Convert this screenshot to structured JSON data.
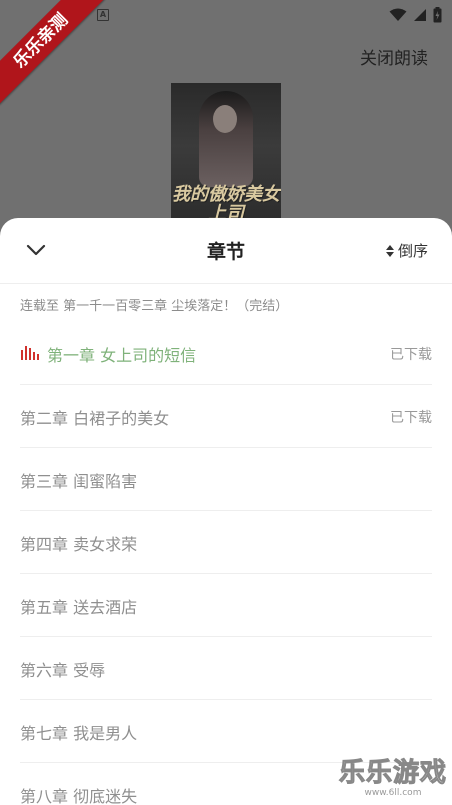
{
  "status_bar": {
    "icon": "a-notification-icon",
    "right_icons": [
      "wifi-icon",
      "signal-icon",
      "battery-charging-icon"
    ]
  },
  "reader": {
    "close_reading_label": "关闭朗读",
    "cover_title": "我的傲娇美女上司"
  },
  "ribbon": {
    "label": "乐乐亲测",
    "color": "#b0151b"
  },
  "sheet": {
    "title": "章节",
    "sort_label": "倒序",
    "serial_info": "连载至  第一千一百零三章 尘埃落定！（完结）",
    "chapters": [
      {
        "title": "第一章 女上司的短信",
        "status": "已下载",
        "active": true
      },
      {
        "title": "第二章 白裙子的美女",
        "status": "已下载",
        "active": false
      },
      {
        "title": "第三章 闺蜜陷害",
        "status": "",
        "active": false
      },
      {
        "title": "第四章 卖女求荣",
        "status": "",
        "active": false
      },
      {
        "title": "第五章 送去酒店",
        "status": "",
        "active": false
      },
      {
        "title": "第六章 受辱",
        "status": "",
        "active": false
      },
      {
        "title": "第七章 我是男人",
        "status": "",
        "active": false
      },
      {
        "title": "第八章 彻底迷失",
        "status": "",
        "active": false
      }
    ]
  },
  "watermark": {
    "label": "乐乐游戏",
    "url": "www.6ll.com"
  },
  "colors": {
    "active_chapter": "#7fb27a",
    "playing_icon": "#d0312d",
    "inactive_chapter": "#8f8f8f"
  }
}
